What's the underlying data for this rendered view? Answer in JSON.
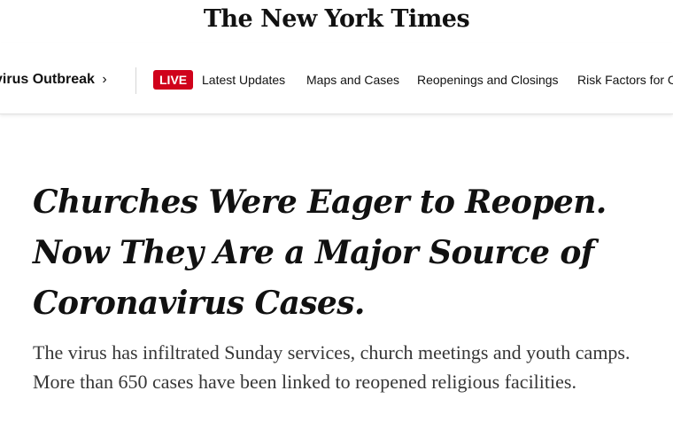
{
  "masthead": {
    "logo_text": "The New York Times"
  },
  "nav": {
    "section_label": "virus Outbreak",
    "section_chevron": "›",
    "live_label": "LIVE",
    "items": [
      {
        "label": "Latest Updates"
      },
      {
        "label": "Maps and Cases"
      },
      {
        "label": "Reopenings and Closings"
      },
      {
        "label": "Risk Factors for C"
      }
    ]
  },
  "article": {
    "headline": "Churches Were Eager to Reopen. Now They Are a Major Source of Coronavirus Cases.",
    "summary": "The virus has infiltrated Sunday services, church meetings and youth camps. More than 650 cases have been linked to reopened religious facilities."
  },
  "colors": {
    "live_badge": "#d0021b",
    "text": "#121212",
    "summary_text": "#363636"
  }
}
